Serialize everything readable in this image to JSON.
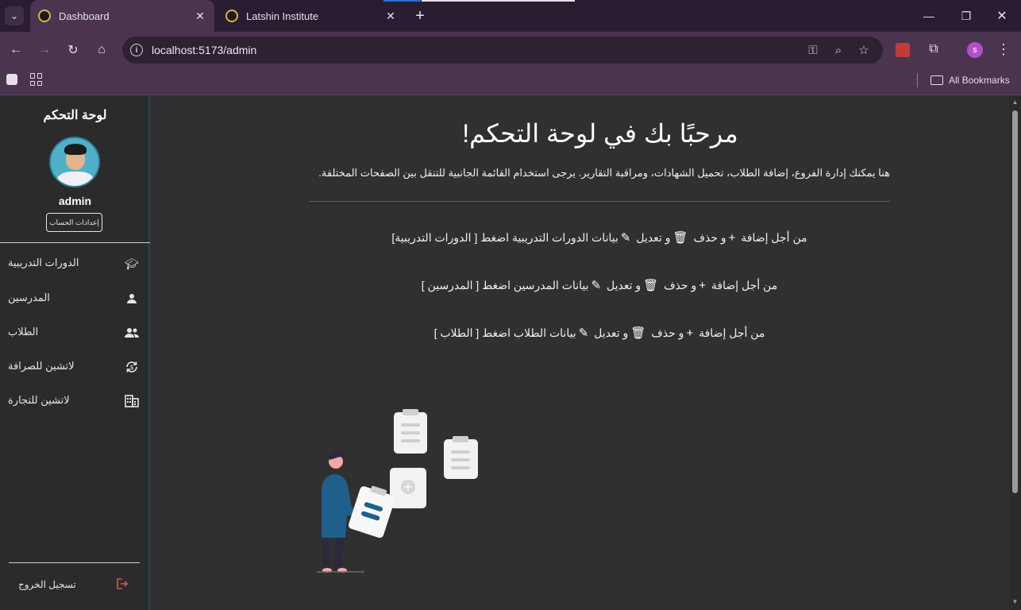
{
  "browser": {
    "tabs": [
      {
        "title": "Dashboard",
        "active": true
      },
      {
        "title": "Latshin Institute",
        "active": false
      }
    ],
    "url": "localhost:5173/admin",
    "profile_initial": "s",
    "bookmarks_label": "All Bookmarks"
  },
  "sidebar": {
    "title": "لوحة التحكم",
    "username": "admin",
    "account_settings": "إعدادات الحساب",
    "items": [
      {
        "label": "الدورات التدريبية",
        "icon": "graduation-cap-icon"
      },
      {
        "label": "المدرسين",
        "icon": "person-icon"
      },
      {
        "label": "الطلاب",
        "icon": "people-icon"
      },
      {
        "label": "لاتشين للصرافة",
        "icon": "currency-exchange-icon"
      },
      {
        "label": "لاتشين للتجارة",
        "icon": "building-icon"
      }
    ],
    "logout": "تسجيل الخروج"
  },
  "main": {
    "welcome": "مرحبًا بك في لوحة التحكم!",
    "intro": "هنا يمكنك إدارة الفروع، إضافة الطلاب، تحميل الشهادات، ومراقبة التقارير. يرجى استخدام القائمة الجانبية للتنقل بين الصفحات المختلفة.",
    "instructions": [
      {
        "pre": "من أجل إضافة",
        "mid1": "و حذف",
        "mid2": "و تعديل",
        "post": "بيانات الدورات التدريبية اضغط [ الدورات التدريبية]"
      },
      {
        "pre": "من أجل إضافة",
        "mid1": "و حذف",
        "mid2": "و تعديل",
        "post": "بيانات المدرسين اضغط [ المدرسين ]"
      },
      {
        "pre": "من أجل إضافة",
        "mid1": "و حذف",
        "mid2": "و تعديل",
        "post": "بيانات الطلاب اضغط [ الطلاب ]"
      }
    ]
  },
  "colors": {
    "accent": "#2d6a86",
    "logout": "#e05353",
    "chrome": "#4a3450",
    "illustration_blue": "#1f5f8b"
  }
}
